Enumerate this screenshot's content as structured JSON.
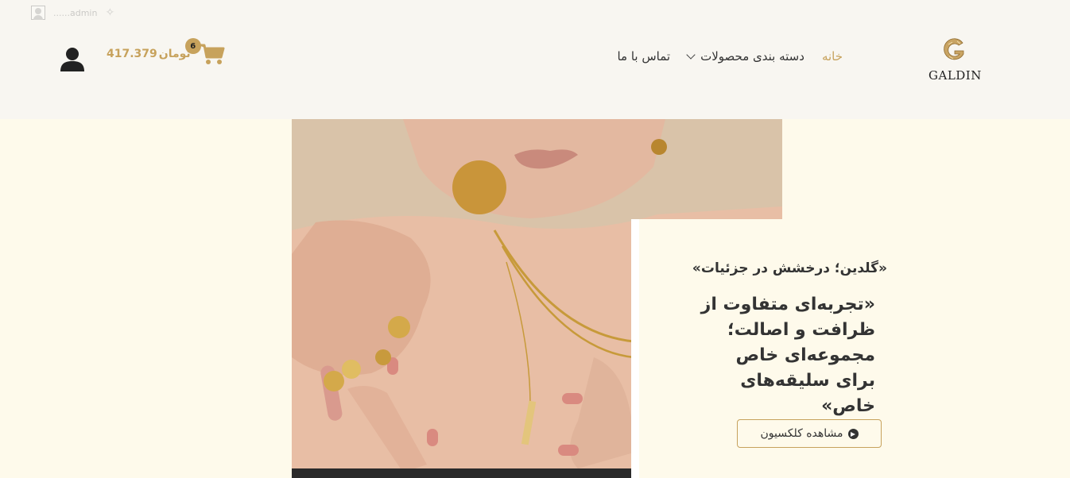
{
  "adminbar": {
    "label": "......admin"
  },
  "logo": {
    "text": "GALDIN"
  },
  "nav": {
    "items": [
      {
        "label": "خانه",
        "active": true
      },
      {
        "label": "دسته بندی محصولات",
        "has_dropdown": true
      },
      {
        "label": "تماس با ما"
      }
    ]
  },
  "cart": {
    "count": "6",
    "amount": "417.379",
    "currency": "تومان"
  },
  "hero": {
    "tagline": "«گلدین؛ درخشش در جزئیات»",
    "headline": "«تجربه‌ای متفاوت از ظرافت و اصالت؛ مجموعه‌ای خاص برای سلیقه‌های خاص»",
    "cta_label": "مشاهده کلکسیون"
  },
  "colors": {
    "accent": "#c7a25c",
    "header_bg": "#f8f6f1",
    "hero_bg": "#fefaeb",
    "text": "#333333"
  },
  "icons": [
    "user-icon",
    "cart-icon",
    "chevron-down-icon",
    "arrow-circle-right-icon",
    "avatar-icon"
  ]
}
